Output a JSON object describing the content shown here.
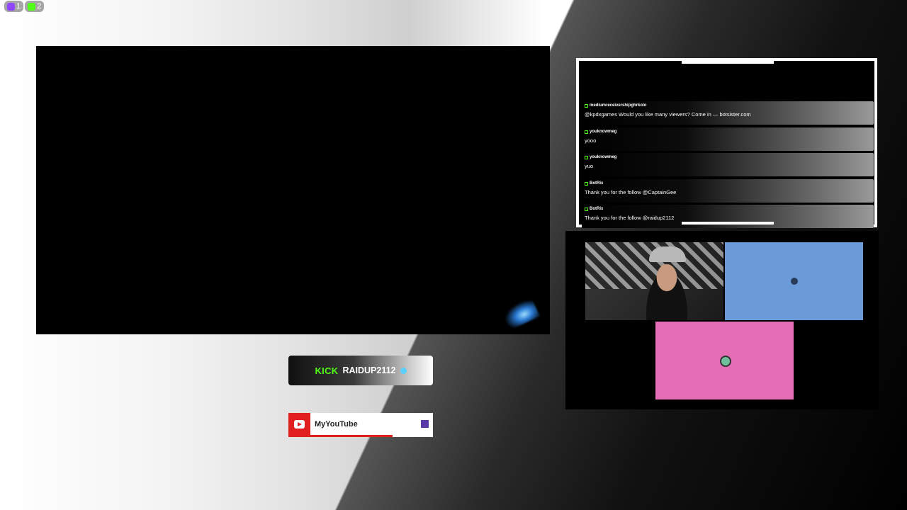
{
  "badges": [
    {
      "platform": "twitch",
      "icon": "twitch-icon",
      "count": "1",
      "color": "#9146ff"
    },
    {
      "platform": "kick",
      "icon": "kick-icon",
      "count": "2",
      "color": "#53fc18"
    }
  ],
  "chat": {
    "messages": [
      {
        "user": "mediumreceivershipghrkolo",
        "text": "@kpdxgames Would you like many viewers? Come in — botsister.com"
      },
      {
        "user": "youknowmeg",
        "text": "yooo"
      },
      {
        "user": "youknowmeg",
        "text": "yuo"
      },
      {
        "user": "BotRix",
        "text": "Thank you for the follow @CaptainGee"
      },
      {
        "user": "BotRix",
        "text": "Thank you for the follow @raidup2112"
      }
    ]
  },
  "kick_card": {
    "logo": "KICK",
    "name": "RAIDUP2112",
    "accent": "#53fc18"
  },
  "youtube_card": {
    "label": "MyYouTube",
    "accent": "#e21f1f"
  }
}
